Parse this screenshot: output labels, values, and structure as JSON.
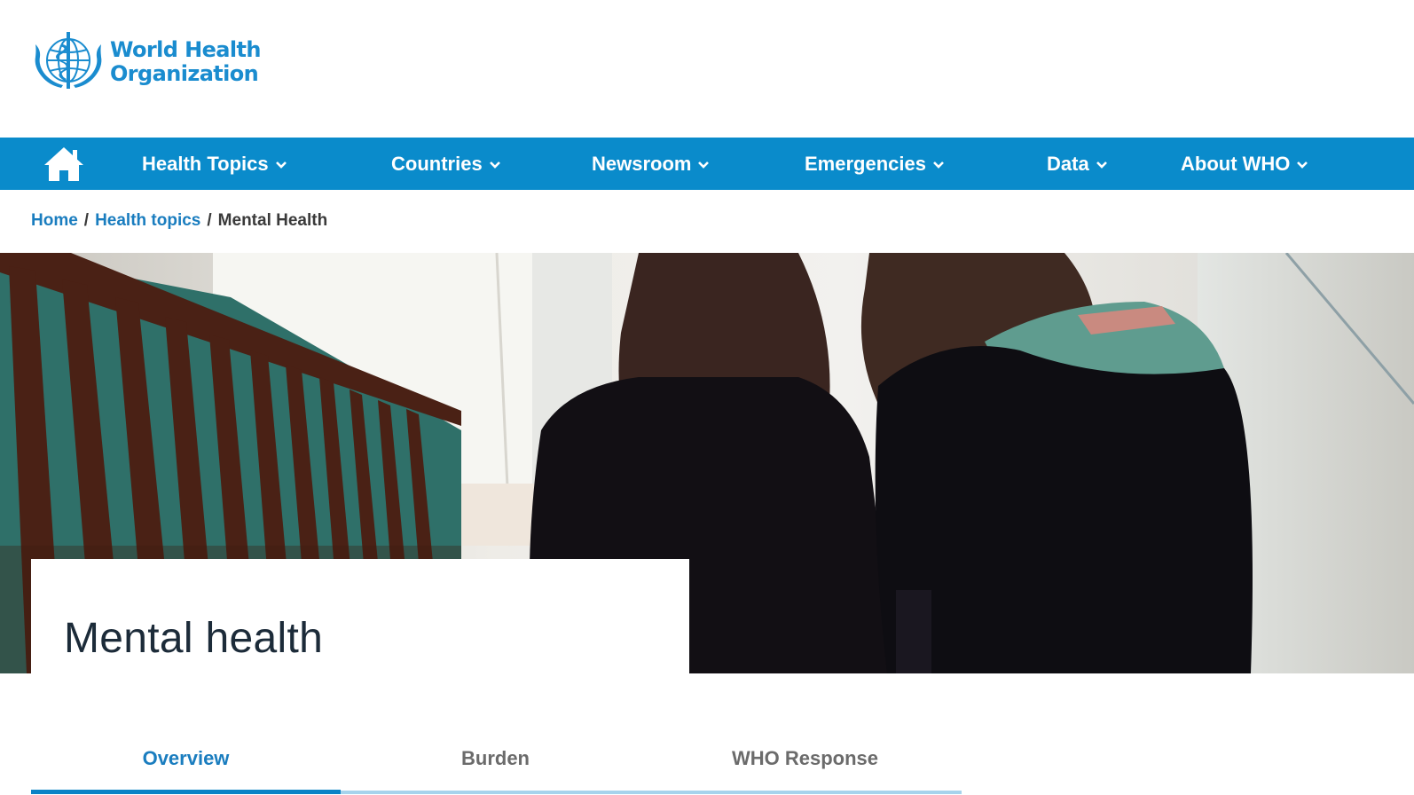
{
  "brand": {
    "logo_line1": "World Health",
    "logo_line2": "Organization",
    "accent": "#0a8bcb",
    "logo_color": "#1a8ccf"
  },
  "nav": {
    "home_icon": "home-icon",
    "items": [
      {
        "label": "Health Topics"
      },
      {
        "label": "Countries"
      },
      {
        "label": "Newsroom"
      },
      {
        "label": "Emergencies"
      },
      {
        "label": "Data"
      },
      {
        "label": "About WHO"
      }
    ],
    "chevron_icon": "chevron-down-icon"
  },
  "breadcrumb": {
    "items": [
      {
        "label": "Home"
      },
      {
        "label": "Health topics"
      }
    ],
    "separator": "/",
    "current": "Mental Health"
  },
  "page": {
    "title": "Mental health"
  },
  "tabs": {
    "items": [
      {
        "label": "Overview",
        "active": true
      },
      {
        "label": "Burden",
        "active": false
      },
      {
        "label": "WHO Response",
        "active": false
      }
    ]
  }
}
